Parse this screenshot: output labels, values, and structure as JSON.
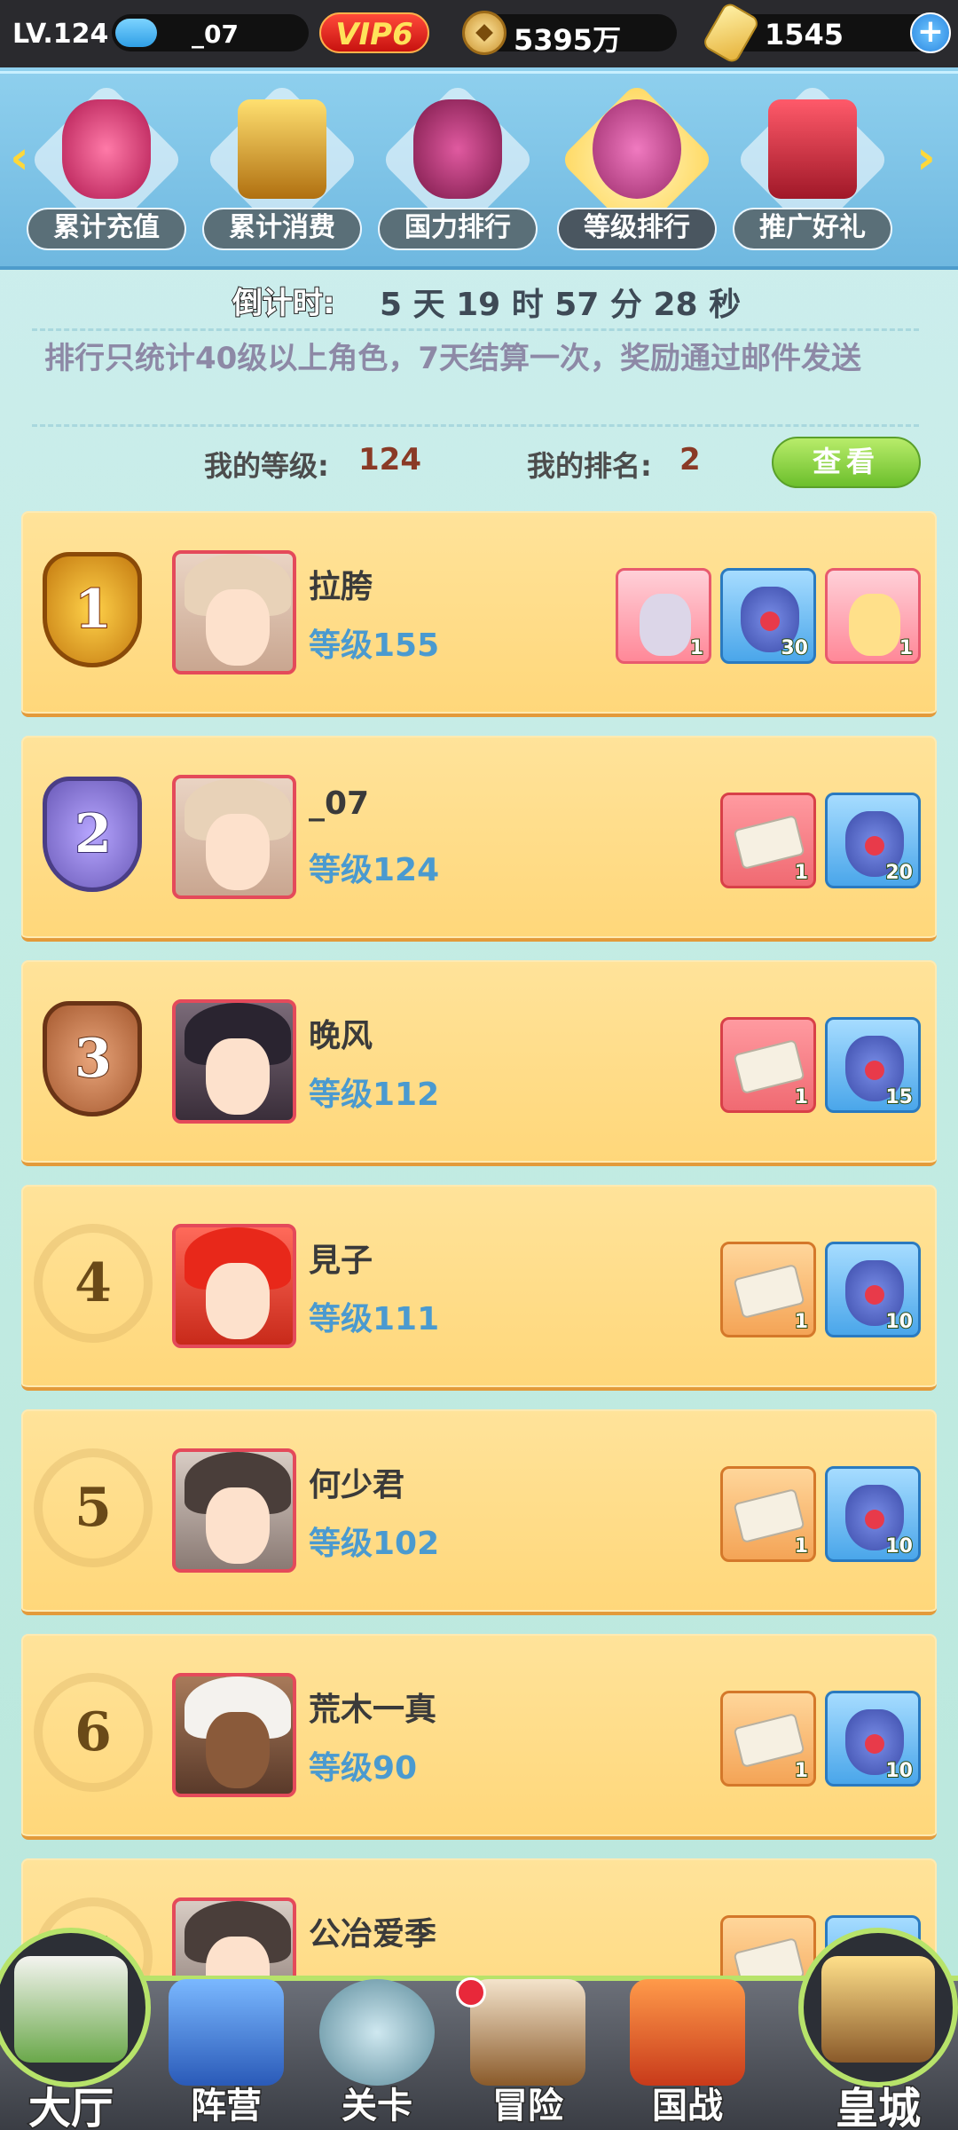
{
  "topbar": {
    "level": "LV.124",
    "username": "_07",
    "xp_fraction": 0.22,
    "vip": "VIP6",
    "coins": "5395万",
    "gold": "1545",
    "plus_icon": "plus-icon"
  },
  "tabs": [
    {
      "label": "累计充值",
      "icon": "money-bag-icon",
      "active": false
    },
    {
      "label": "累计消费",
      "icon": "gold-chest-icon",
      "active": false
    },
    {
      "label": "国力排行",
      "icon": "oni-mask-icon",
      "active": false
    },
    {
      "label": "等级排行",
      "icon": "crossed-swords-icon",
      "active": true
    },
    {
      "label": "推广好礼",
      "icon": "gift-box-icon",
      "active": false
    }
  ],
  "info": {
    "countdown_label": "倒计时:",
    "countdown_value": "5 天 19 时 57 分 28 秒",
    "rule": "排行只统计40级以上角色，7天结算一次，奖励通过邮件发送",
    "my_level_label": "我的等级:",
    "my_level": "124",
    "my_rank_label": "我的排名:",
    "my_rank": "2",
    "view_button": "查看"
  },
  "ranking": [
    {
      "rank": "1",
      "name": "拉胯",
      "level": "等级155",
      "rewards": [
        {
          "type": "portrait",
          "qty": "1"
        },
        {
          "type": "bag",
          "qty": "30"
        },
        {
          "type": "portrait",
          "qty": "1"
        }
      ]
    },
    {
      "rank": "2",
      "name": "_07",
      "level": "等级124",
      "rewards": [
        {
          "type": "scroll",
          "qty": "1"
        },
        {
          "type": "bag",
          "qty": "20"
        }
      ]
    },
    {
      "rank": "3",
      "name": "晚风",
      "level": "等级112",
      "rewards": [
        {
          "type": "scroll",
          "qty": "1"
        },
        {
          "type": "bag",
          "qty": "15"
        }
      ]
    },
    {
      "rank": "4",
      "name": "見子",
      "level": "等级111",
      "rewards": [
        {
          "type": "scroll",
          "qty": "1"
        },
        {
          "type": "bag",
          "qty": "10"
        }
      ]
    },
    {
      "rank": "5",
      "name": "何少君",
      "level": "等级102",
      "rewards": [
        {
          "type": "scroll",
          "qty": "1"
        },
        {
          "type": "bag",
          "qty": "10"
        }
      ]
    },
    {
      "rank": "6",
      "name": "荒木一真",
      "level": "等级90",
      "rewards": [
        {
          "type": "scroll",
          "qty": "1"
        },
        {
          "type": "bag",
          "qty": "10"
        }
      ]
    },
    {
      "rank": "7",
      "name": "公冶爱季",
      "level": "",
      "rewards": [
        {
          "type": "scroll",
          "qty": ""
        },
        {
          "type": "bag",
          "qty": ""
        }
      ]
    }
  ],
  "bottom_nav": [
    {
      "label": "大厅",
      "icon": "castle-icon"
    },
    {
      "label": "阵营",
      "icon": "go-board-scroll-icon"
    },
    {
      "label": "关卡",
      "icon": "crossed-swords-icon"
    },
    {
      "label": "冒险",
      "icon": "ship-icon"
    },
    {
      "label": "国战",
      "icon": "war-banners-icon"
    },
    {
      "label": "皇城",
      "icon": "palace-icon"
    }
  ],
  "colors": {
    "accent_green": "#b7e36a",
    "level_blue": "#4a9ad0",
    "rank_brown": "#8a3a26"
  }
}
